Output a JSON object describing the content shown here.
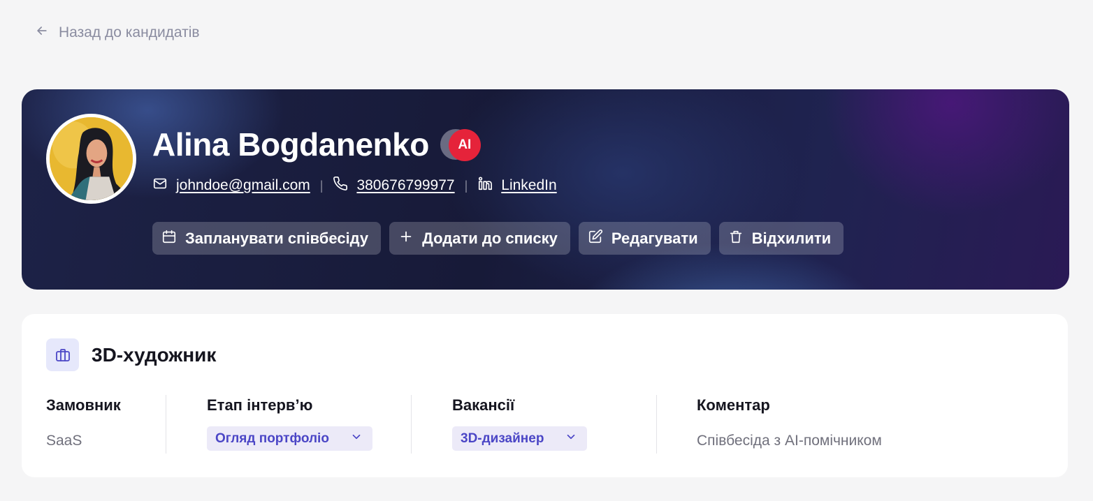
{
  "nav": {
    "back_label": "Назад до кандидатів"
  },
  "candidate": {
    "name": "Alina Bogdanenko",
    "ai_badge": "AI",
    "email": "johndoe@gmail.com",
    "phone": "380676799977",
    "linkedin": "LinkedIn",
    "separator": "|"
  },
  "actions": {
    "schedule": "Запланувати співбесіду",
    "add_to_list": "Додати до списку",
    "edit": "Редагувати",
    "reject": "Відхилити"
  },
  "job": {
    "title": "3D-художник",
    "customer_label": "Замовник",
    "customer_value": "SaaS",
    "stage_label": "Етап інтерв’ю",
    "stage_value": "Огляд портфоліо",
    "vacancy_label": "Вакансії",
    "vacancy_value": "3D-дизайнер",
    "comment_label": "Коментар",
    "comment_value": "Співбесіда з AI-помічником"
  },
  "colors": {
    "accent": "#4b46c6",
    "ai_badge": "#e5233a",
    "pill_bg": "#eceaf8",
    "page_bg": "#f5f5f6"
  },
  "icons": {
    "back": "arrow-left-icon",
    "email": "mail-icon",
    "phone": "phone-icon",
    "linkedin": "linkedin-icon",
    "schedule": "calendar-icon",
    "add": "plus-icon",
    "edit": "edit-icon",
    "reject": "trash-icon",
    "job": "briefcase-icon",
    "dropdown": "chevron-down-icon"
  }
}
